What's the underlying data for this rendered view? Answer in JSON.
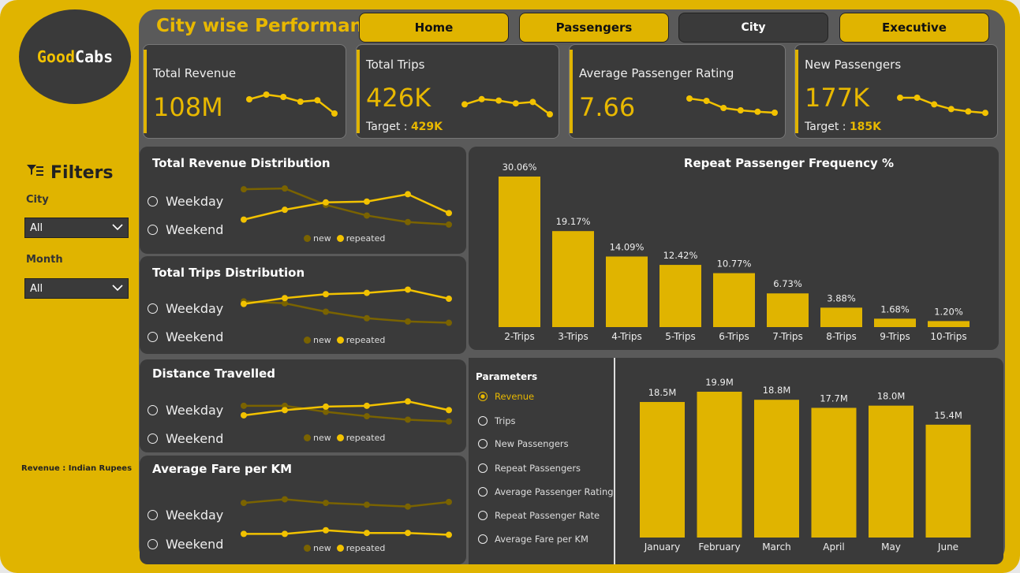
{
  "app": {
    "logo_good": "Good",
    "logo_cabs": "Cabs",
    "title": "City wise Performance"
  },
  "nav": [
    {
      "label": "Home",
      "active": false
    },
    {
      "label": "Passengers",
      "active": false
    },
    {
      "label": "City",
      "active": true
    },
    {
      "label": "Executive",
      "active": false
    }
  ],
  "filters": {
    "heading": "Filters",
    "city_label": "City",
    "city_value": "All",
    "month_label": "Month",
    "month_value": "All"
  },
  "note": "Revenue : Indian Rupees",
  "kpis": [
    {
      "title": "Total Revenue",
      "value": "108M",
      "target_label": "",
      "target_value": "",
      "trend": [
        5,
        6,
        5.5,
        4.5,
        4.8,
        2
      ]
    },
    {
      "title": "Total Trips",
      "value": "426K",
      "target_label": "Target : ",
      "target_value": "429K",
      "trend": [
        4.6,
        5.7,
        5.4,
        4.8,
        5.1,
        2.5
      ]
    },
    {
      "title": "Average Passenger Rating",
      "value": "7.66",
      "target_label": "",
      "target_value": "",
      "trend": [
        6,
        5.5,
        4,
        3.5,
        3.2,
        3
      ]
    },
    {
      "title": "New Passengers",
      "value": "177K",
      "target_label": "Target : ",
      "target_value": "185K",
      "trend": [
        6,
        6,
        4.6,
        3.6,
        3.1,
        2.8
      ]
    }
  ],
  "distribution_panels": [
    {
      "title": "Total Revenue Distribution",
      "opt1": "Weekday",
      "opt2": "Weekend",
      "leg_new": "new",
      "leg_rep": "repeated",
      "new": [
        6.5,
        6.6,
        4.6,
        3.3,
        2.5,
        2.2
      ],
      "repeated": [
        2.8,
        4,
        4.9,
        5,
        5.9,
        3.6
      ]
    },
    {
      "title": "Total Trips Distribution",
      "opt1": "Weekday",
      "opt2": "Weekend",
      "leg_new": "new",
      "leg_rep": "repeated",
      "new": [
        5.2,
        4.9,
        3.6,
        2.6,
        2.1,
        1.9
      ],
      "repeated": [
        4.8,
        5.7,
        6.3,
        6.5,
        7,
        5.6
      ]
    },
    {
      "title": "Distance Travelled",
      "opt1": "Weekday",
      "opt2": "Weekend",
      "leg_new": "new",
      "leg_rep": "repeated",
      "new": [
        5.6,
        5.6,
        4.9,
        4.4,
        4,
        3.8
      ],
      "repeated": [
        4.5,
        5.1,
        5.5,
        5.6,
        6.1,
        5.1
      ]
    },
    {
      "title": "Average Fare per KM",
      "opt1": "Weekday",
      "opt2": "Weekend",
      "leg_new": "new",
      "leg_rep": "repeated",
      "new": [
        6,
        6.4,
        6,
        5.8,
        5.6,
        6.1
      ],
      "repeated": [
        2.6,
        2.6,
        3,
        2.7,
        2.7,
        2.5
      ]
    }
  ],
  "colors": {
    "accent": "#e0b400",
    "line_new": "#7a6300",
    "line_rep": "#f2c200",
    "panel": "#3a3a3a"
  },
  "parameters": {
    "title": "Parameters",
    "options": [
      "Revenue",
      "Trips",
      "New Passengers",
      "Repeat Passengers",
      "Average Passenger Rating",
      "Repeat Passenger Rate",
      "Average Fare per KM"
    ],
    "selected": "Revenue"
  },
  "chart_data": [
    {
      "type": "bar",
      "title": "Repeat Passenger Frequency %",
      "categories": [
        "2-Trips",
        "3-Trips",
        "4-Trips",
        "5-Trips",
        "6-Trips",
        "7-Trips",
        "8-Trips",
        "9-Trips",
        "10-Trips"
      ],
      "values": [
        30.06,
        19.17,
        14.09,
        12.42,
        10.77,
        6.73,
        3.88,
        1.68,
        1.2
      ],
      "labels": [
        "30.06%",
        "19.17%",
        "14.09%",
        "12.42%",
        "10.77%",
        "6.73%",
        "3.88%",
        "1.68%",
        "1.20%"
      ],
      "ylim": [
        0,
        30.06
      ]
    },
    {
      "type": "bar",
      "title": "",
      "categories": [
        "January",
        "February",
        "March",
        "April",
        "May",
        "June"
      ],
      "values": [
        18.5,
        19.9,
        18.8,
        17.7,
        18.0,
        15.4
      ],
      "labels": [
        "18.5M",
        "19.9M",
        "18.8M",
        "17.7M",
        "18.0M",
        "15.4M"
      ],
      "ylim": [
        0,
        19.9
      ]
    }
  ]
}
